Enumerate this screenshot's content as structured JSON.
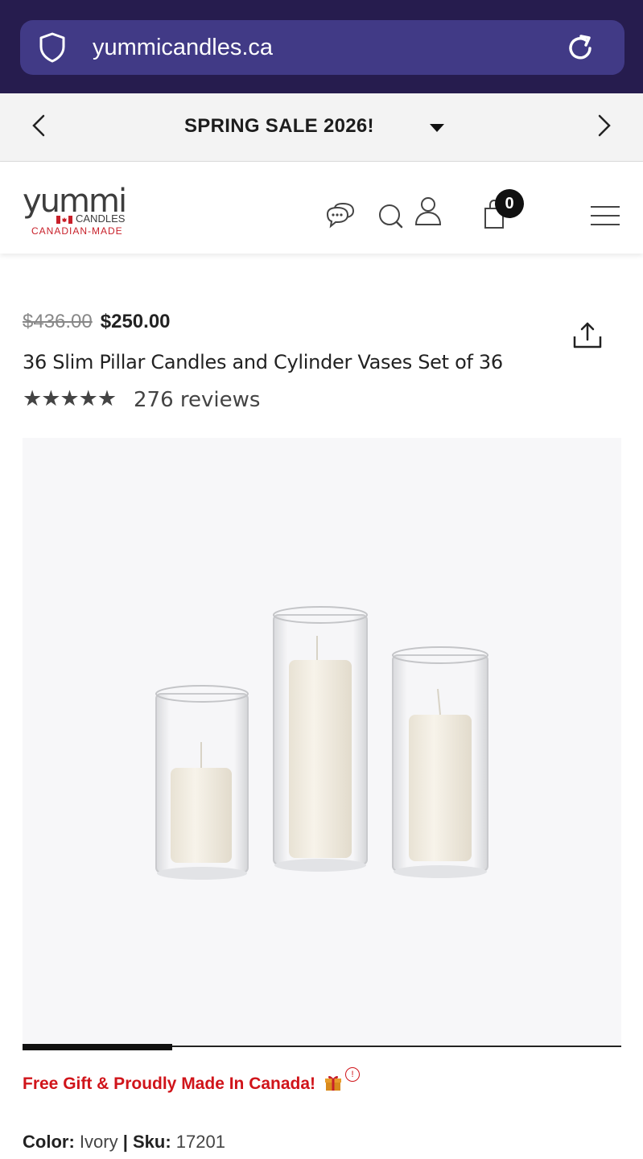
{
  "browser": {
    "url": "yummicandles.ca",
    "bg_color": "#261c4e",
    "pill_color": "#413a86"
  },
  "announcement": {
    "text": "SPRING SALE 2026!"
  },
  "header": {
    "logo": {
      "brand": "yummi",
      "sub": "CANDLES",
      "tagline": "CANADIAN-MADE"
    },
    "cart_count": "0",
    "icons": [
      "chat-icon",
      "search-icon",
      "user-icon",
      "bag-icon",
      "menu-icon"
    ]
  },
  "product": {
    "old_price": "$436.00",
    "new_price": "$250.00",
    "title": "36 Slim Pillar Candles and Cylinder Vases Set of 36",
    "stars": "★★★★★",
    "reviews": "276 reviews",
    "image_progress": 0.25,
    "promo": "Free Gift & Proudly Made In Canada!",
    "promo_color": "#d0141a",
    "color_label": "Color:",
    "color_value": "Ivory",
    "sku_label": "Sku:",
    "sku_value": "17201",
    "separator": "|"
  }
}
